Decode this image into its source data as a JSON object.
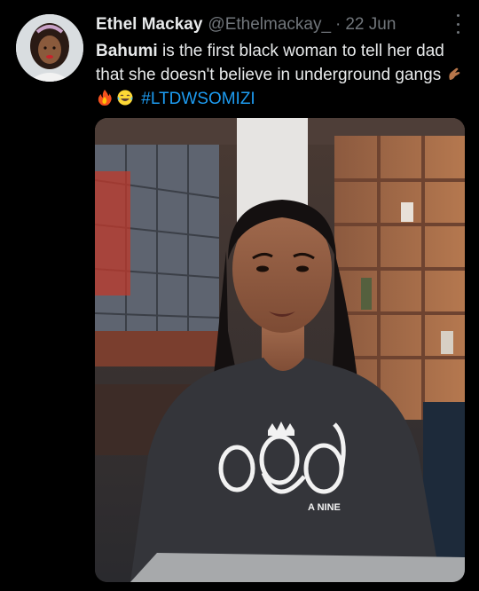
{
  "tweet": {
    "author_name": "Ethel Mackay",
    "author_handle": "@Ethelmackay_",
    "separator": "·",
    "date": "22 Jun",
    "text_bold": "Bahumi",
    "text_rest": " is the first black woman to tell her dad that she doesn't believe in underground gangs ",
    "emojis": [
      "pinching-hand-emoji",
      "fire-emoji",
      "tears-of-joy-emoji"
    ],
    "hashtag": "#LTDWSOMIZI",
    "sweatshirt_logo": "A NINE",
    "colors": {
      "background": "#000000",
      "text": "#e7e9ea",
      "secondary": "#71767b",
      "link": "#1d9bf0"
    }
  }
}
